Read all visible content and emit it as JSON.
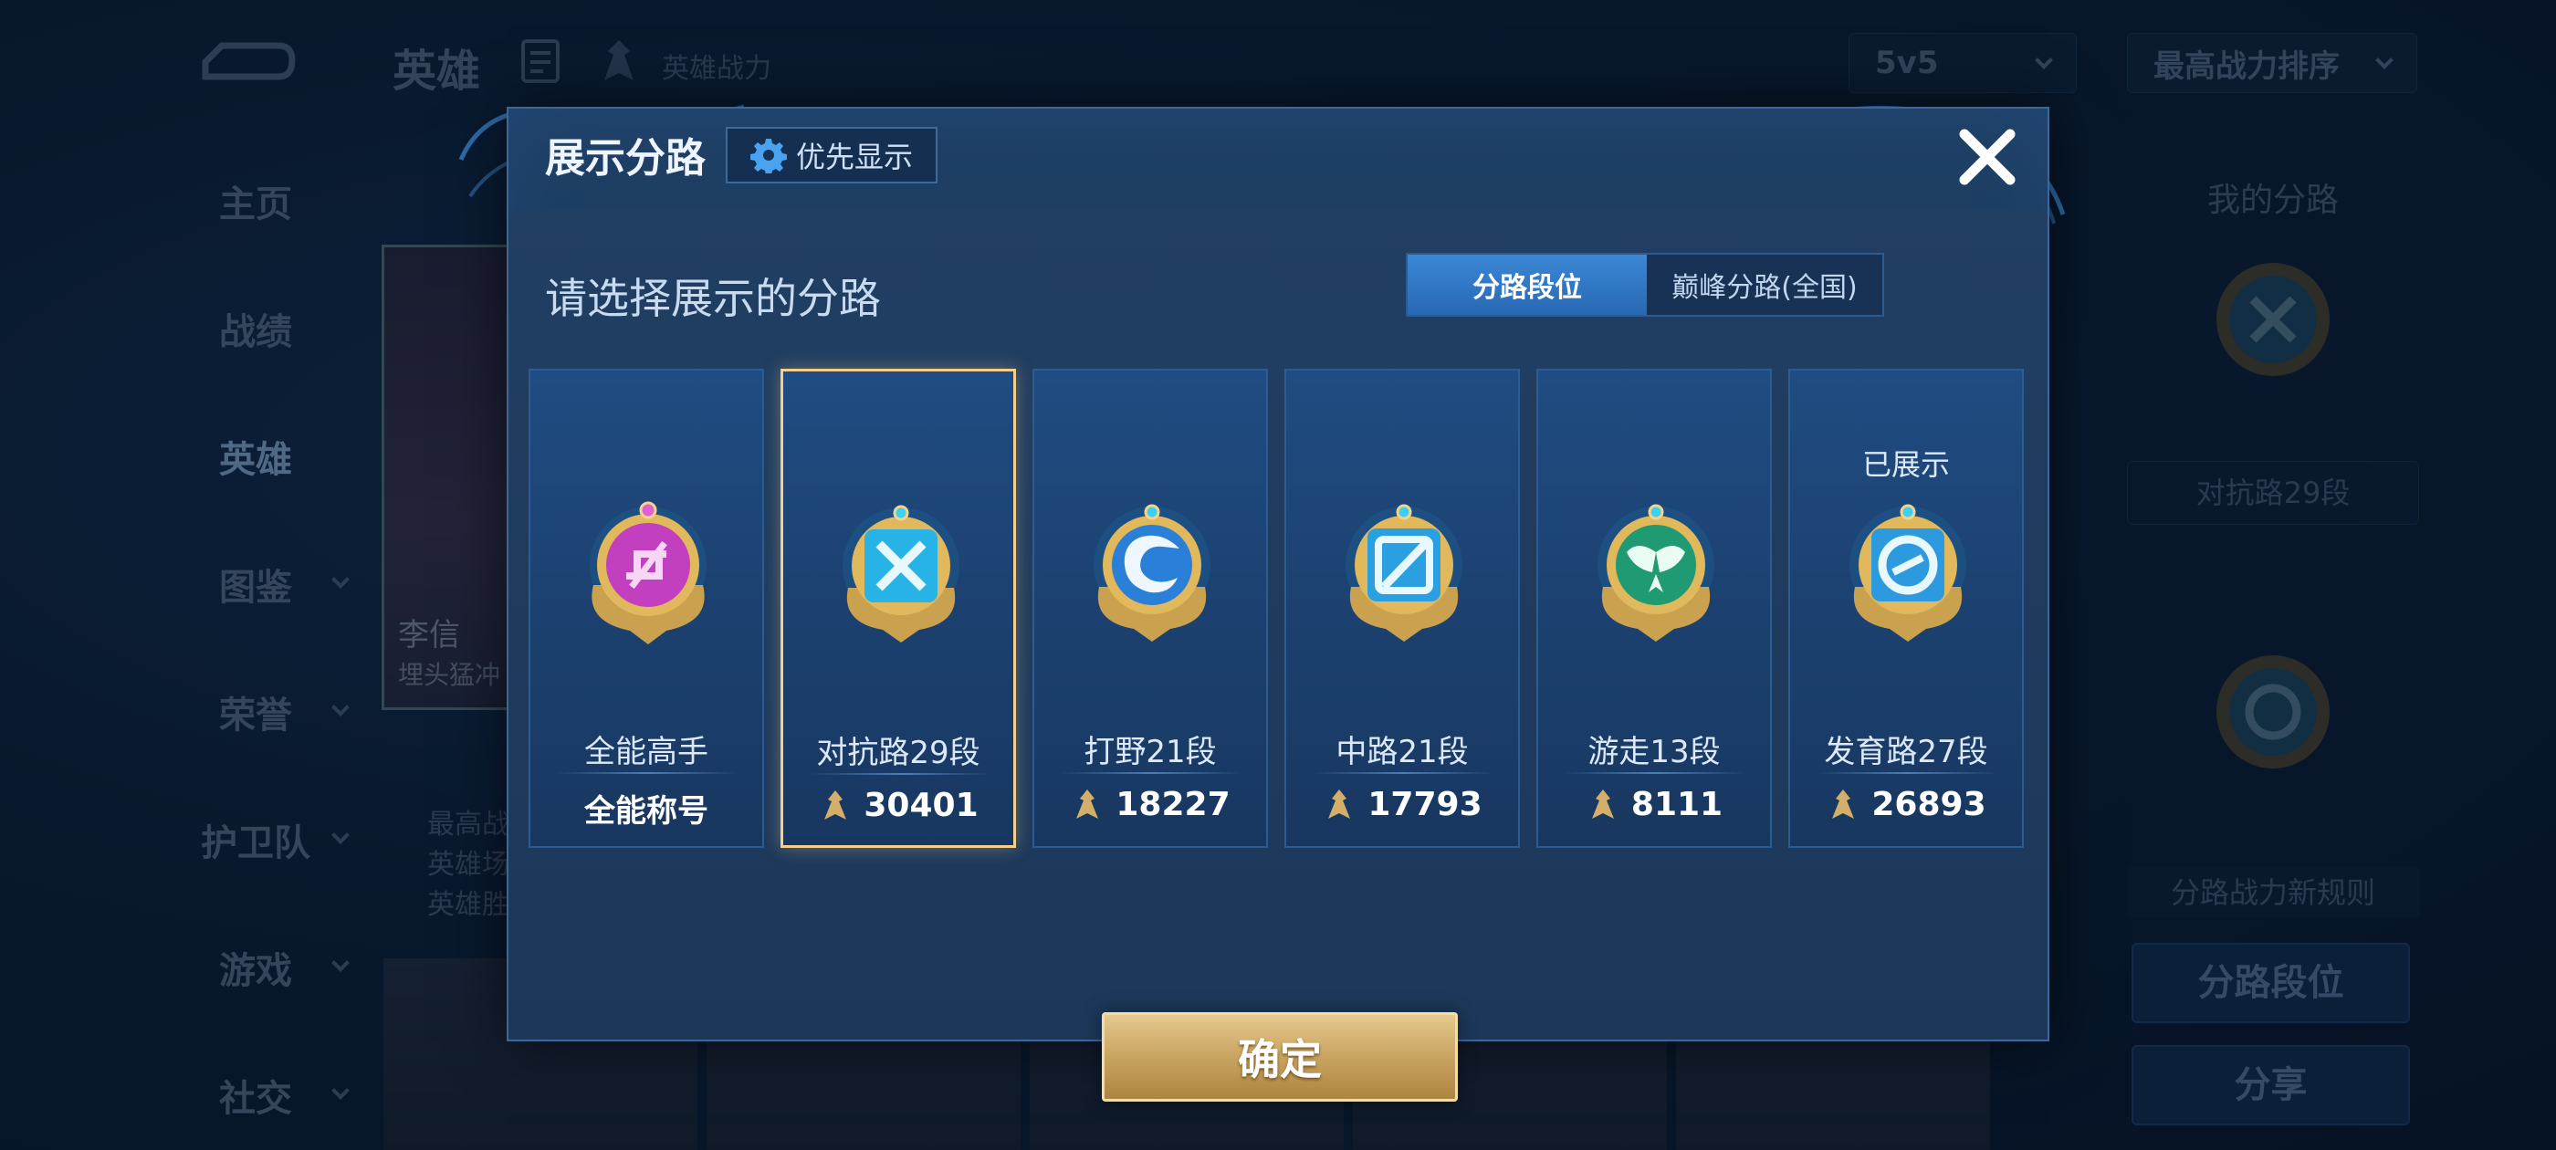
{
  "background": {
    "header": {
      "title": "英雄",
      "power_label": "英雄战力",
      "mode_select": "5v5",
      "sort_select": "最高战力排序"
    },
    "side_nav": [
      {
        "label": "主页",
        "has_chevron": false,
        "active": false
      },
      {
        "label": "战绩",
        "has_chevron": false,
        "active": false
      },
      {
        "label": "英雄",
        "has_chevron": false,
        "active": true
      },
      {
        "label": "图鉴",
        "has_chevron": true,
        "active": false
      },
      {
        "label": "荣誉",
        "has_chevron": true,
        "active": false
      },
      {
        "label": "护卫队",
        "has_chevron": true,
        "active": false
      },
      {
        "label": "游戏",
        "has_chevron": true,
        "active": false
      },
      {
        "label": "社交",
        "has_chevron": true,
        "active": false
      }
    ],
    "hero_card": {
      "name": "李信",
      "subtitle": "埋头猛冲",
      "stats": [
        "最高战",
        "英雄场",
        "英雄胜"
      ]
    },
    "right_panel": {
      "title": "我的分路",
      "lane_label": "对抗路29段",
      "rule_label": "分路战力新规则",
      "lane_rank_button": "分路段位",
      "share_button": "分享"
    }
  },
  "modal": {
    "title": "展示分路",
    "priority_button": "优先显示",
    "subtitle": "请选择展示的分路",
    "tabs": [
      {
        "label": "分路段位",
        "active": true
      },
      {
        "label": "巅峰分路(全国)",
        "active": false
      }
    ],
    "cards": [
      {
        "lane": "全能高手",
        "footer": "全能称号",
        "has_power": false,
        "selected": false,
        "shown_label": "",
        "icon": "all-round-badge-icon",
        "gem_color": "#c23fbf"
      },
      {
        "lane": "对抗路29段",
        "footer": "30401",
        "has_power": true,
        "selected": true,
        "shown_label": "",
        "icon": "clash-lane-badge-icon",
        "gem_color": "#2fb8e8"
      },
      {
        "lane": "打野21段",
        "footer": "18227",
        "has_power": true,
        "selected": false,
        "shown_label": "",
        "icon": "jungle-badge-icon",
        "gem_color": "#2a7fd8"
      },
      {
        "lane": "中路21段",
        "footer": "17793",
        "has_power": true,
        "selected": false,
        "shown_label": "",
        "icon": "mid-lane-badge-icon",
        "gem_color": "#2aa0e0"
      },
      {
        "lane": "游走13段",
        "footer": "8111",
        "has_power": true,
        "selected": false,
        "shown_label": "",
        "icon": "roam-badge-icon",
        "gem_color": "#1f9a72"
      },
      {
        "lane": "发育路27段",
        "footer": "26893",
        "has_power": true,
        "selected": false,
        "shown_label": "已展示",
        "icon": "farm-lane-badge-icon",
        "gem_color": "#2d9ae0"
      }
    ],
    "confirm_button": "确定"
  },
  "colors": {
    "gold": "#d4af6a",
    "modal_bg": "#1f4066",
    "accent_blue": "#3b88d6",
    "selected_border": "#f3cf8b"
  }
}
